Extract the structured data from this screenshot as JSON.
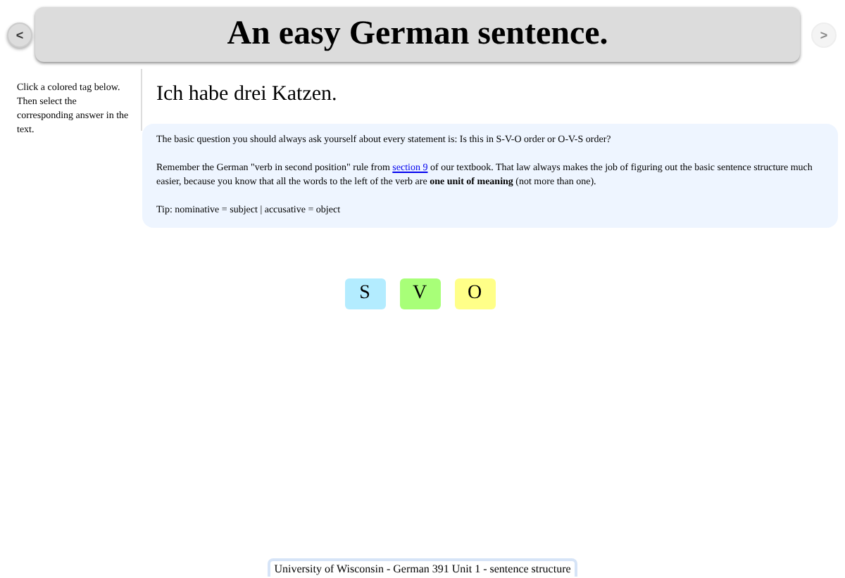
{
  "header": {
    "title": "An easy German sentence.",
    "prev": {
      "label": "<",
      "disabled": false
    },
    "next": {
      "label": ">",
      "disabled": true
    }
  },
  "sidebar": {
    "instructions": "Click a colored tag below. Then select the corresponding answer in the text."
  },
  "sentence": "Ich habe drei Katzen.",
  "info": {
    "paragraphs": [
      {
        "kind": "text",
        "text": "The basic question you should always ask yourself about every statement is: Is this in S-V-O order or O-V-S order?"
      },
      {
        "kind": "link",
        "before": "Remember the German \"verb in second position\" rule from ",
        "link": "section 9",
        "after": " of our textbook. That law always makes the job of figuring out the basic sentence structure much easier, because you know that all the words to the left of the verb are **one unit of meaning** (not more than one)."
      },
      {
        "kind": "text",
        "text": "Tip: nominative = subject | accusative = object"
      }
    ]
  },
  "tags": [
    {
      "label": "S",
      "color": "#b3ecff",
      "selected": false
    },
    {
      "label": "V",
      "color": "#a8ff78",
      "selected": false
    },
    {
      "label": "O",
      "color": "#ffff88",
      "selected": false
    }
  ],
  "footer": "University of Wisconsin - German 391 Unit 1 - sentence structure"
}
